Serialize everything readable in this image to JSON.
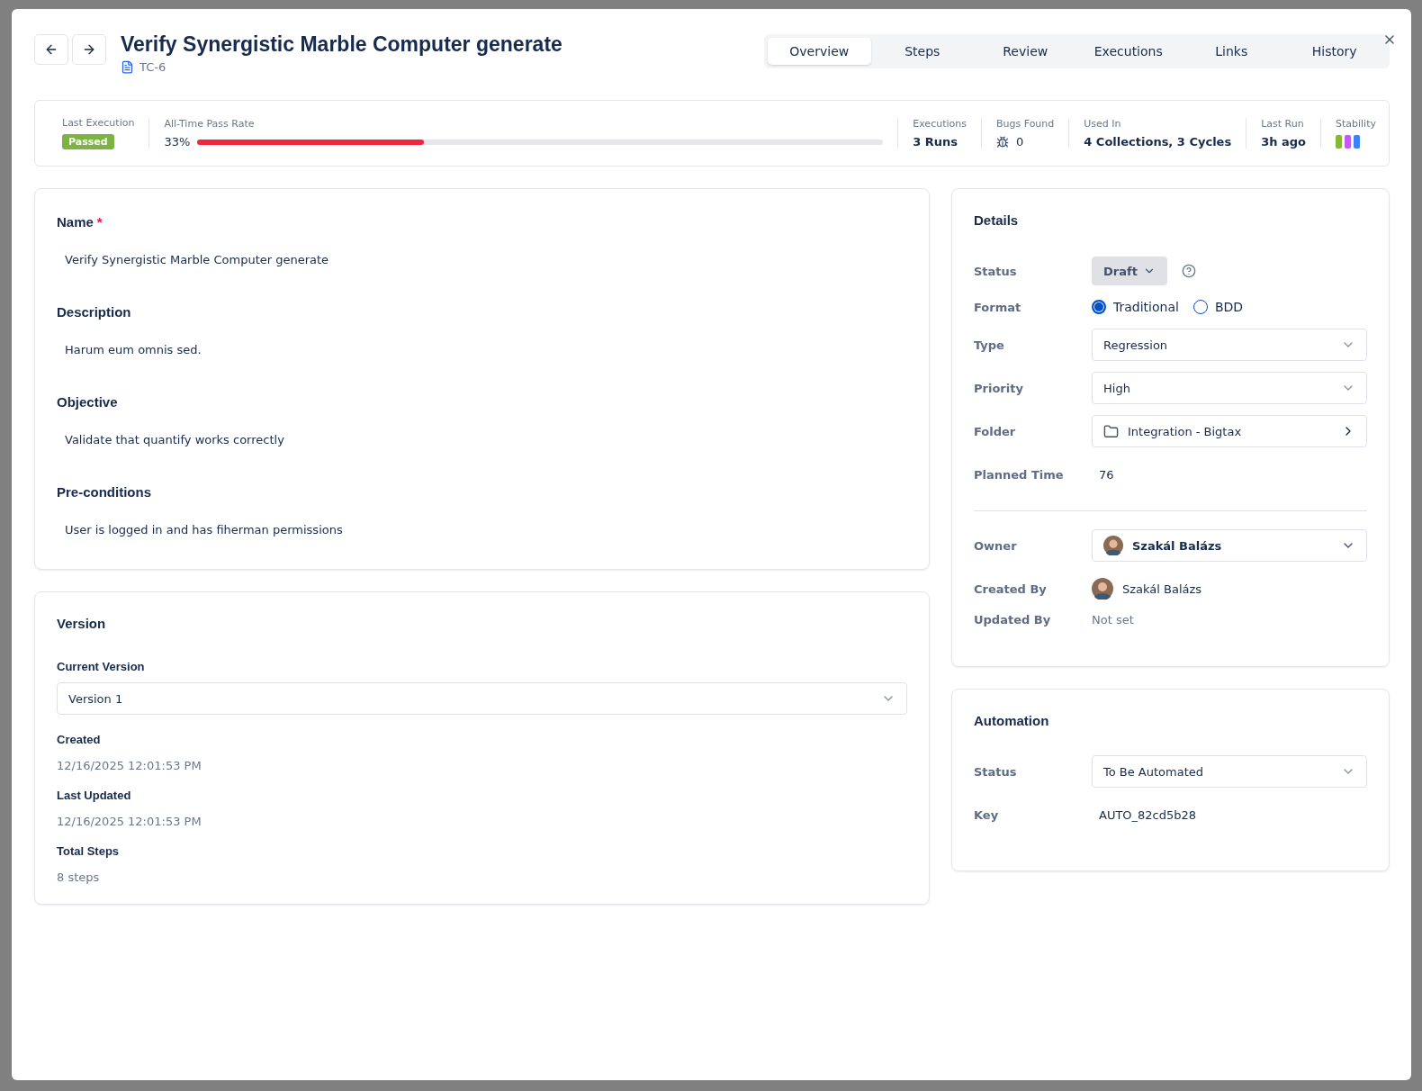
{
  "header": {
    "title": "Verify Synergistic Marble Computer generate",
    "key": "TC-6"
  },
  "tabs": [
    {
      "label": "Overview",
      "selected": true
    },
    {
      "label": "Steps",
      "selected": false
    },
    {
      "label": "Review",
      "selected": false
    },
    {
      "label": "Executions",
      "selected": false
    },
    {
      "label": "Links",
      "selected": false
    },
    {
      "label": "History",
      "selected": false
    }
  ],
  "stats": {
    "last_execution": {
      "label": "Last Execution",
      "badge": "Passed"
    },
    "pass_rate": {
      "label": "All-Time Pass Rate",
      "reading": "33%",
      "level": 0.33
    },
    "items": [
      {
        "kind": "text",
        "label": "Executions",
        "value": "3 Runs"
      },
      {
        "kind": "bugs",
        "label": "Bugs Found",
        "value": "0"
      },
      {
        "kind": "text",
        "label": "Used In",
        "value": "4 Collections, 3 Cycles"
      },
      {
        "kind": "text",
        "label": "Last Run",
        "value": "3h ago"
      }
    ],
    "stability": {
      "label": "Stability",
      "bars": [
        {
          "color": "#84b935"
        },
        {
          "color": "#c05cf0"
        },
        {
          "color": "#3b82f6"
        }
      ]
    }
  },
  "fields": [
    {
      "label": "Name",
      "required_mark": "*",
      "value": "Verify Synergistic Marble Computer generate"
    },
    {
      "label": "Description",
      "value": "Harum eum omnis sed."
    },
    {
      "label": "Objective",
      "value": "Validate that quantify works correctly"
    },
    {
      "label": "Pre-conditions",
      "value": "User is logged in and has fiherman permissions"
    }
  ],
  "version": {
    "title": "Version",
    "current_label": "Current Version",
    "current": "Version 1",
    "info": [
      {
        "label": "Created",
        "value": "12/16/2025 12:01:53 PM"
      },
      {
        "label": "Last Updated",
        "value": "12/16/2025 12:01:53 PM"
      },
      {
        "label": "Total Steps",
        "value": "8 steps"
      }
    ]
  },
  "details": {
    "title": "Details",
    "rows": [
      {
        "kind": "status",
        "label": "Status",
        "value": "Draft"
      },
      {
        "kind": "radio",
        "label": "Format",
        "options": [
          {
            "label": "Traditional",
            "selected": true
          },
          {
            "label": "BDD",
            "selected": false
          }
        ]
      },
      {
        "kind": "select",
        "label": "Type",
        "value": "Regression"
      },
      {
        "kind": "select",
        "label": "Priority",
        "value": "High"
      },
      {
        "kind": "folder",
        "label": "Folder",
        "value": "Integration - Bigtax"
      },
      {
        "kind": "text",
        "label": "Planned Time",
        "value": "76"
      },
      {
        "kind": "divider"
      },
      {
        "kind": "user-select",
        "label": "Owner",
        "value": "Szakál Balázs"
      },
      {
        "kind": "user",
        "label": "Created By",
        "value": "Szakál Balázs"
      },
      {
        "kind": "muted",
        "label": "Updated By",
        "value": "Not set"
      }
    ]
  },
  "automation": {
    "title": "Automation",
    "rows": [
      {
        "kind": "select",
        "label": "Status",
        "value": "To Be Automated"
      },
      {
        "kind": "text",
        "label": "Key",
        "value": "AUTO_82cd5b28"
      }
    ]
  }
}
